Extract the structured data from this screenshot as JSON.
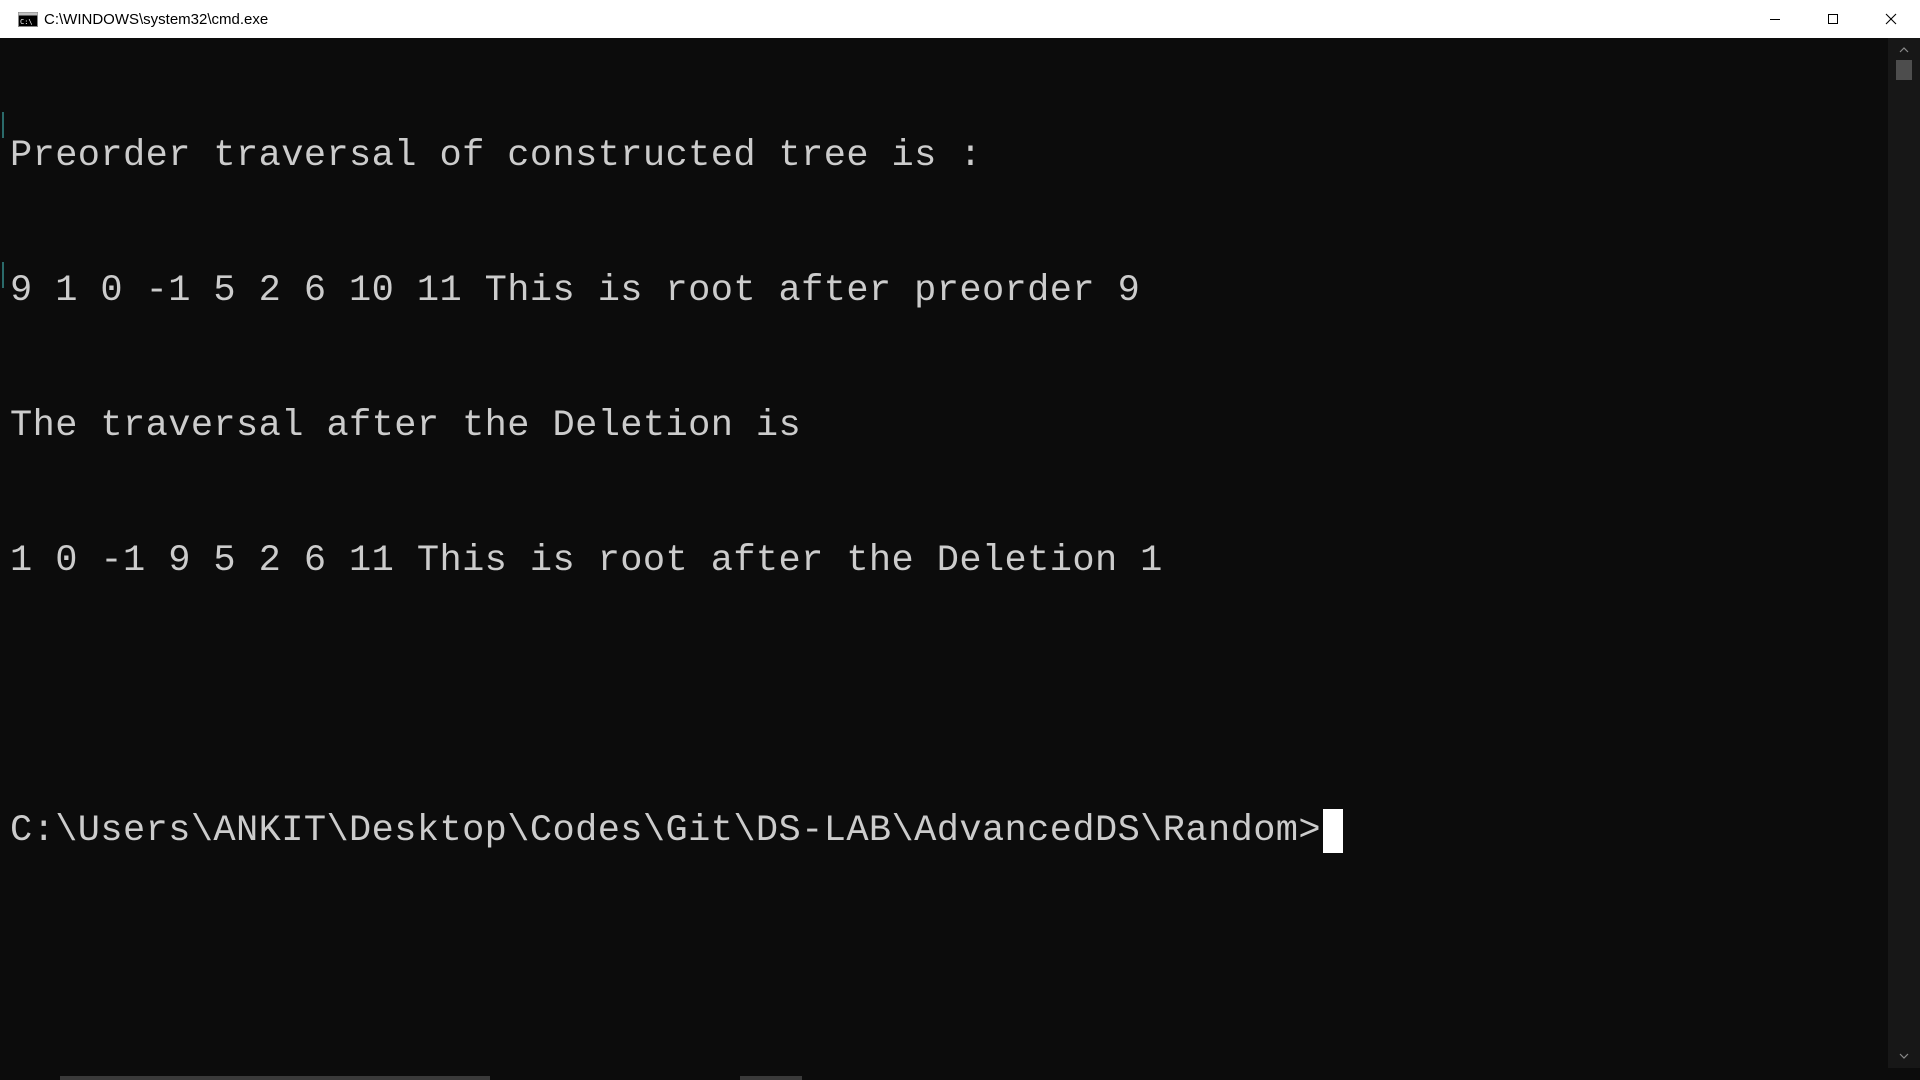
{
  "window": {
    "title": "C:\\WINDOWS\\system32\\cmd.exe",
    "icon": "cmd-icon",
    "controls": {
      "minimize": "minimize-icon",
      "maximize": "maximize-icon",
      "close": "close-icon"
    }
  },
  "terminal": {
    "lines": [
      "Preorder traversal of constructed tree is :",
      "9 1 0 -1 5 2 6 10 11 This is root after preorder 9",
      "The traversal after the Deletion is",
      "1 0 -1 9 5 2 6 11 This is root after the Deletion 1",
      "",
      "C:\\Users\\ANKIT\\Desktop\\Codes\\Git\\DS-LAB\\AdvancedDS\\Random>"
    ]
  },
  "colors": {
    "terminal_background": "#0c0c0c",
    "terminal_foreground": "#cccccc",
    "cursor": "#ffffff",
    "titlebar_background": "#ffffff"
  }
}
